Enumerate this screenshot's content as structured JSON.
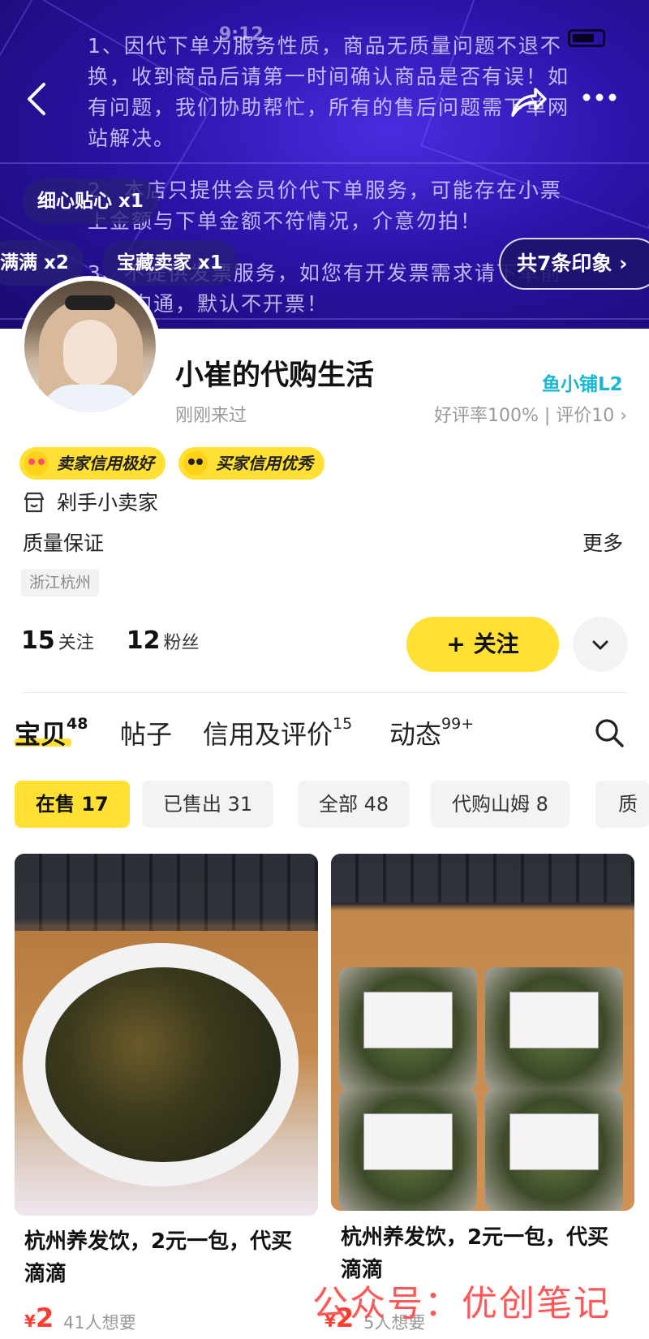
{
  "status_bar": {
    "time": "9:12"
  },
  "banner": {
    "notice_lines": [
      "1、因代下单为服务性质，商品无质量问题不退不换，收到商品后请第一时间确认商品是否有误！如有问题，我们协助帮忙，所有的售后问题需下单网站解决。",
      "2、本店只提供会员价代下单服务，可能存在小票上金额与下单金额不符情况，介意勿拍！",
      "3、不提供发票服务，如您有开发票需求请下单前提前沟通，默认不开票！"
    ],
    "tags": [
      "细心贴心 x1",
      "满满 x2",
      "宝藏卖家 x1"
    ],
    "impressions": "共7条印象 ›"
  },
  "profile": {
    "shop_name": "小崔的代购生活",
    "last_seen": "刚刚来过",
    "level_badge": "鱼小铺L2",
    "rating": "好评率100% | 评价10 ›",
    "credit_badges": [
      "卖家信用极好",
      "买家信用优秀"
    ],
    "seller_type": "剁手小卖家",
    "quality": "质量保证",
    "more": "更多",
    "location": "浙江杭州",
    "following_count": "15",
    "following_label": "关注",
    "followers_count": "12",
    "followers_label": "粉丝",
    "follow_button": "+ 关注"
  },
  "tabs": [
    {
      "label": "宝贝",
      "badge": "48"
    },
    {
      "label": "帖子",
      "badge": ""
    },
    {
      "label": "信用及评价",
      "badge": "15"
    },
    {
      "label": "动态",
      "badge": "99+"
    }
  ],
  "filters": [
    "在售 17",
    "已售出 31",
    "全部 48",
    "代购山姆 8",
    "质"
  ],
  "products": [
    {
      "title": "杭州养发饮，2元一包，代买滴滴",
      "price": "2",
      "currency": "¥",
      "wants": "41人想要"
    },
    {
      "title": "杭州养发饮，2元一包，代买滴滴",
      "price": "2",
      "currency": "¥",
      "wants": "5人想要"
    }
  ],
  "watermark": "公众号：优创笔记",
  "colors": {
    "accent": "#ffe033",
    "price": "#ff3b30",
    "banner": "#2a14a8",
    "level": "#18b8d2"
  }
}
